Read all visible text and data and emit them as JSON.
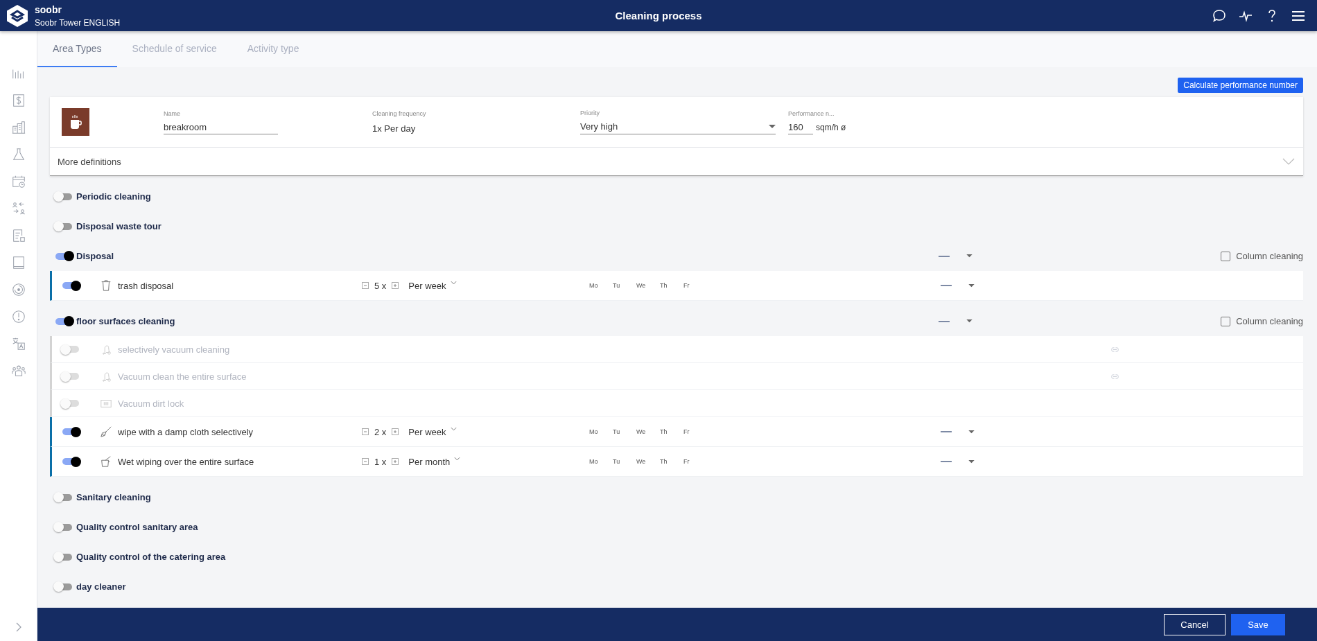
{
  "app": {
    "name": "soobr",
    "subtitle": "Soobr Tower ENGLISH"
  },
  "header": {
    "title": "Cleaning process"
  },
  "tabs": [
    {
      "label": "Area Types",
      "selected": true
    },
    {
      "label": "Schedule of service",
      "selected": false
    },
    {
      "label": "Activity type",
      "selected": false
    }
  ],
  "calculate_button": "Calculate performance number",
  "area": {
    "fields": [
      {
        "kind": "text",
        "label": "Name",
        "value": "breakroom"
      },
      {
        "kind": "static",
        "label": "Cleaning frequency",
        "value": "1x Per day"
      },
      {
        "kind": "select",
        "label": "Priority",
        "value": "Very high"
      },
      {
        "kind": "number",
        "label": "Performance n...",
        "value": "160",
        "unit": "sqm/h ø"
      }
    ],
    "more": {
      "label": "More definitions",
      "expanded": false
    }
  },
  "sections": [
    {
      "title": "Periodic cleaning",
      "on": false
    },
    {
      "title": "Disposal waste tour",
      "on": false
    },
    {
      "title": "Disposal",
      "on": true,
      "column_cleaning": {
        "label": "Column cleaning",
        "checked": false
      },
      "tasks": [
        {
          "label": "trash disposal",
          "on": true,
          "count": "5 x",
          "frequency": "Per week",
          "days": [
            "Mo",
            "Tu",
            "We",
            "Th",
            "Fr"
          ],
          "linked": false
        }
      ]
    },
    {
      "title": "floor surfaces cleaning",
      "on": true,
      "column_cleaning": {
        "label": "Column cleaning",
        "checked": false
      },
      "tasks": [
        {
          "label": "selectively vacuum cleaning",
          "on": false,
          "linked": true
        },
        {
          "label": "Vacuum clean the entire surface",
          "on": false,
          "linked": true
        },
        {
          "label": "Vacuum dirt lock",
          "on": false,
          "linked": false
        },
        {
          "label": "wipe with a damp cloth selectively",
          "on": true,
          "count": "2 x",
          "frequency": "Per week",
          "days": [
            "Mo",
            "Tu",
            "We",
            "Th",
            "Fr"
          ],
          "linked": false
        },
        {
          "label": "Wet wiping over the entire surface",
          "on": true,
          "count": "1 x",
          "frequency": "Per month",
          "days": [
            "Mo",
            "Tu",
            "We",
            "Th",
            "Fr"
          ],
          "linked": false
        }
      ]
    },
    {
      "title": "Sanitary cleaning",
      "on": false
    },
    {
      "title": "Quality control sanitary area",
      "on": false
    },
    {
      "title": "Quality control of the catering area",
      "on": false
    },
    {
      "title": "day cleaner",
      "on": false
    }
  ],
  "footer": {
    "cancel": "Cancel",
    "save": "Save"
  }
}
